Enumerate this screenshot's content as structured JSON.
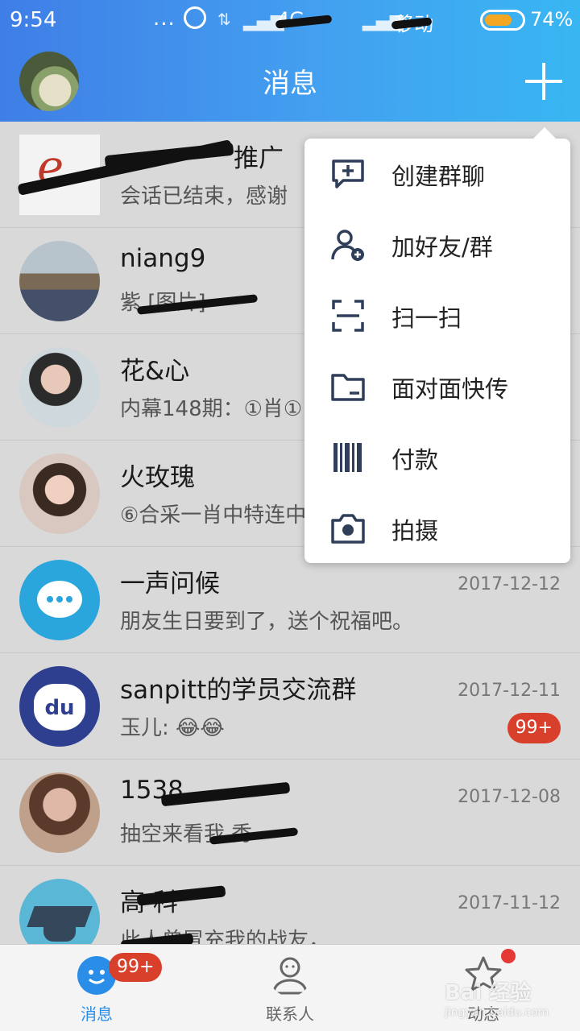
{
  "status_bar": {
    "time": "9:54",
    "dots": "...",
    "network": "4G",
    "carrier2": "移动",
    "battery": "74%"
  },
  "header": {
    "title": "消息"
  },
  "conversations": [
    {
      "name": "推广",
      "preview": "会话已结束，感谢",
      "date": "",
      "badge": ""
    },
    {
      "name": "niang9",
      "preview": "紫 [图片]",
      "date": "",
      "badge": ""
    },
    {
      "name": "花&心",
      "preview": "内幕148期：①肖①",
      "date": "",
      "badge": ""
    },
    {
      "name": "火玫瑰",
      "preview": "⑥合采一肖中特连中",
      "date": "",
      "badge": ""
    },
    {
      "name": "一声问候",
      "preview": "朋友生日要到了，送个祝福吧。",
      "date": "2017-12-12",
      "badge": ""
    },
    {
      "name": "sanpitt的学员交流群",
      "preview": "玉儿: 😂😂",
      "date": "2017-12-11",
      "badge": "99+"
    },
    {
      "name": "1538",
      "preview": "抽空来看我 秀",
      "date": "2017-12-08",
      "badge": ""
    },
    {
      "name": "高 科",
      "preview": "此人曾冒充我的战友，",
      "date": "2017-11-12",
      "badge": ""
    }
  ],
  "menu": {
    "items": [
      {
        "label": "创建群聊",
        "icon": "create-group-chat-icon"
      },
      {
        "label": "加好友/群",
        "icon": "add-friend-icon"
      },
      {
        "label": "扫一扫",
        "icon": "scan-icon"
      },
      {
        "label": "面对面快传",
        "icon": "folder-transfer-icon"
      },
      {
        "label": "付款",
        "icon": "barcode-icon"
      },
      {
        "label": "拍摄",
        "icon": "camera-icon"
      }
    ]
  },
  "tabbar": {
    "messages": "消息",
    "messages_badge": "99+",
    "contacts": "联系人",
    "moments": "动态"
  },
  "watermark": {
    "brand": "Bai 经验",
    "url": "jingyan.baidu.com"
  },
  "colors": {
    "accent": "#2a8ee8",
    "badge": "#d9402b"
  }
}
